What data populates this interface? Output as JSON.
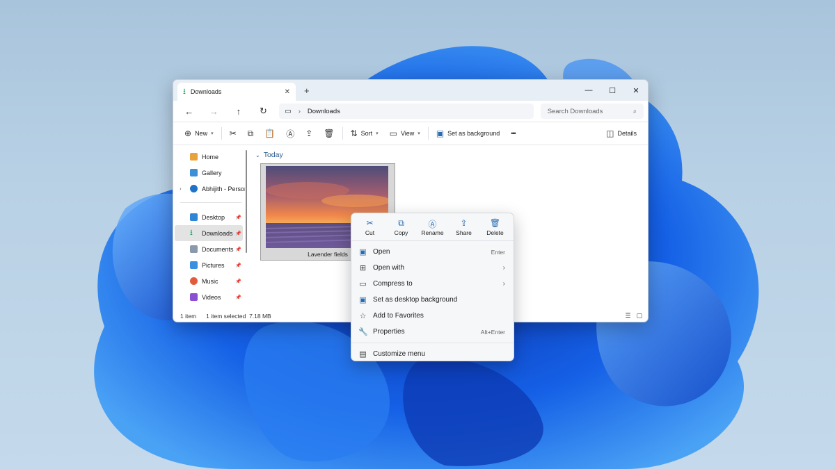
{
  "window": {
    "tab_label": "Downloads",
    "address": "Downloads",
    "search_placeholder": "Search Downloads"
  },
  "toolbar": {
    "new_label": "New",
    "sort_label": "Sort",
    "view_label": "View",
    "set_bg_label": "Set as background",
    "more_label": "•••",
    "details_label": "Details"
  },
  "sidebar": {
    "items": [
      {
        "label": "Home",
        "icon": "home-icon",
        "color": "#e8a33d"
      },
      {
        "label": "Gallery",
        "icon": "gallery-icon",
        "color": "#3d8fd6"
      },
      {
        "label": "Abhijith - Personal",
        "icon": "onedrive-icon",
        "color": "#1e73c9"
      },
      {
        "label": "Desktop",
        "icon": "desktop-icon",
        "color": "#2e86d4"
      },
      {
        "label": "Downloads",
        "icon": "download-icon",
        "color": "#1aa260"
      },
      {
        "label": "Documents",
        "icon": "documents-icon",
        "color": "#8a99ab"
      },
      {
        "label": "Pictures",
        "icon": "pictures-icon",
        "color": "#3b8ee0"
      },
      {
        "label": "Music",
        "icon": "music-icon",
        "color": "#e25b3c"
      },
      {
        "label": "Videos",
        "icon": "videos-icon",
        "color": "#8b4fd1"
      }
    ]
  },
  "main": {
    "group_label": "Today",
    "file_name": "Lavender fields"
  },
  "status": {
    "count": "1 item",
    "selected": "1 item selected",
    "size": "7.18 MB"
  },
  "context_menu": {
    "quick_actions": [
      {
        "label": "Cut",
        "icon": "cut-icon"
      },
      {
        "label": "Copy",
        "icon": "copy-icon"
      },
      {
        "label": "Rename",
        "icon": "rename-icon"
      },
      {
        "label": "Share",
        "icon": "share-icon"
      },
      {
        "label": "Delete",
        "icon": "delete-icon"
      }
    ],
    "items": [
      {
        "label": "Open",
        "shortcut": "Enter",
        "icon": "open-icon"
      },
      {
        "label": "Open with",
        "icon": "open-with-icon"
      },
      {
        "label": "Compress to",
        "icon": "compress-icon"
      },
      {
        "label": "Set as desktop background",
        "icon": "set-background-icon"
      },
      {
        "label": "Add to Favorites",
        "icon": "star-icon"
      },
      {
        "label": "Properties",
        "shortcut": "Alt+Enter",
        "icon": "properties-icon"
      },
      {
        "label": "Customize menu",
        "icon": "customize-menu-icon"
      }
    ]
  },
  "colors": {
    "accent": "#2b6cb0",
    "wallpaper_blue": "#1e5bd8"
  }
}
